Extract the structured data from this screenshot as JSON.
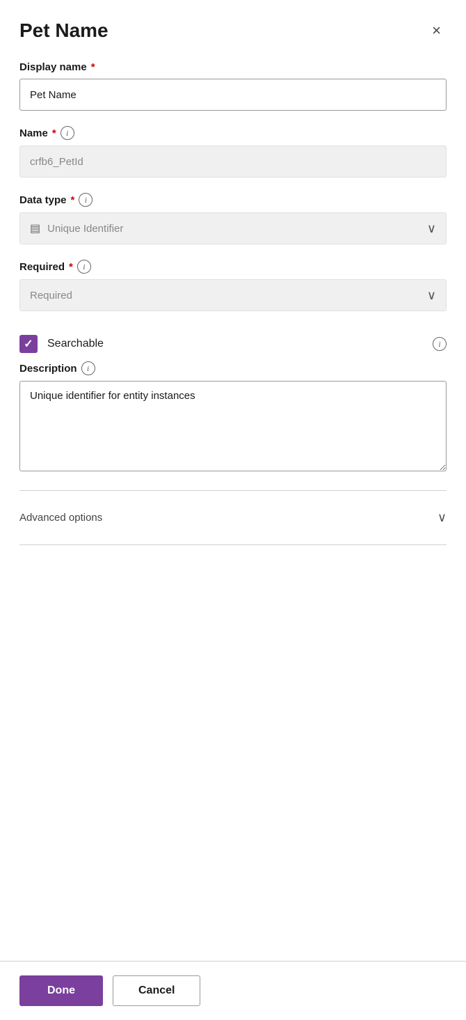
{
  "panel": {
    "title": "Pet Name",
    "close_label": "×"
  },
  "display_name": {
    "label": "Display name",
    "required": true,
    "value": "Pet Name",
    "placeholder": "Pet Name"
  },
  "name": {
    "label": "Name",
    "required": true,
    "has_info": true,
    "value": "crfb6_PetId",
    "placeholder": "crfb6_PetId"
  },
  "data_type": {
    "label": "Data type",
    "required": true,
    "has_info": true,
    "icon": "▤",
    "value": "Unique Identifier",
    "placeholder": "Unique Identifier"
  },
  "required_field": {
    "label": "Required",
    "required": true,
    "has_info": true,
    "value": "Required",
    "placeholder": "Required"
  },
  "searchable": {
    "label": "Searchable",
    "checked": true,
    "has_info": true
  },
  "description": {
    "label": "Description",
    "has_info": true,
    "value": "Unique identifier for entity instances",
    "placeholder": ""
  },
  "advanced_options": {
    "label": "Advanced options"
  },
  "footer": {
    "done_label": "Done",
    "cancel_label": "Cancel"
  }
}
